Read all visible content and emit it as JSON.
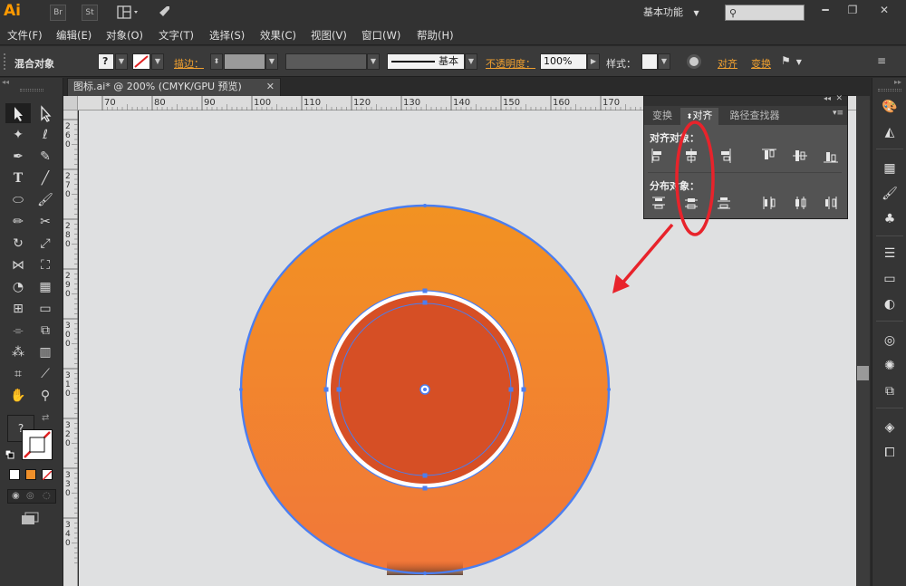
{
  "app": {
    "logo": "Ai"
  },
  "titlebar": {
    "bridge_label": "Br",
    "stock_label": "St",
    "workspace": "基本功能",
    "search_placeholder": ""
  },
  "menu": [
    "文件(F)",
    "编辑(E)",
    "对象(O)",
    "文字(T)",
    "选择(S)",
    "效果(C)",
    "视图(V)",
    "窗口(W)",
    "帮助(H)"
  ],
  "controlbar": {
    "object_type": "混合对象",
    "stroke_label": "描边：",
    "brush_label": "基本",
    "opacity_label": "不透明度：",
    "opacity_value": "100%",
    "style_label": "样式：",
    "align_link": "对齐",
    "transform_link": "变换"
  },
  "document": {
    "tab_title": "图标.ai* @ 200% (CMYK/GPU 预览)"
  },
  "ruler": {
    "top_ticks": [
      "70",
      "80",
      "90",
      "100",
      "110",
      "120",
      "130",
      "140",
      "150",
      "160",
      "170"
    ],
    "left_ticks": [
      "260",
      "270",
      "280",
      "290",
      "300",
      "310",
      "320",
      "330",
      "340"
    ]
  },
  "align_panel": {
    "tabs": [
      "变换",
      "对齐",
      "路径查找器"
    ],
    "active_tab": "对齐",
    "align_objects_label": "对齐对象：",
    "distribute_objects_label": "分布对象："
  },
  "colors": {
    "outer_top": "#f29222",
    "outer_bottom": "#f1773a",
    "inner": "#d64f25",
    "selection": "#4b7ef0",
    "annotation": "#e8232b"
  }
}
